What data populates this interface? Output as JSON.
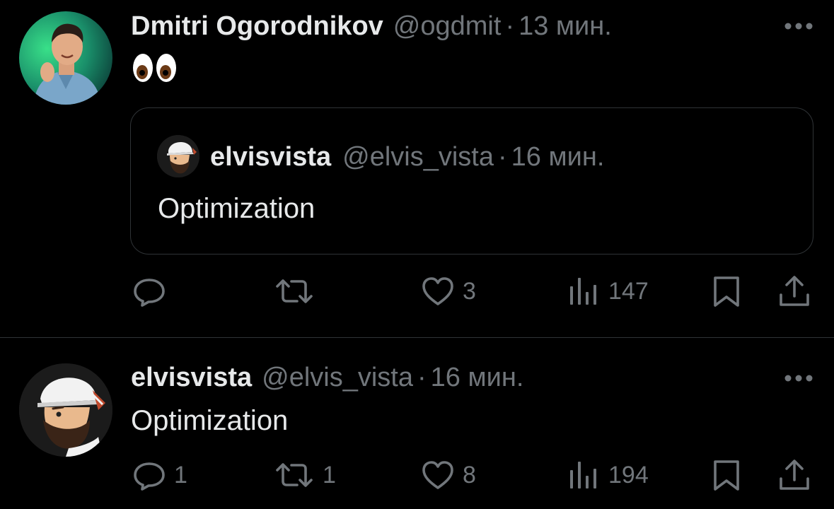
{
  "colors": {
    "background": "#000000",
    "primary_text": "#e7e9ea",
    "secondary_text": "#71767b",
    "border": "#2f3336"
  },
  "tweets": [
    {
      "author": {
        "display_name": "Dmitri Ogorodnikov",
        "handle": "@ogdmit",
        "separator": "·",
        "time": "13 мин.",
        "avatar": "photo-avatar"
      },
      "content": {
        "emoji": "eyes-emoji"
      },
      "quote": {
        "display_name": "elvisvista",
        "handle": "@elvis_vista",
        "separator": "·",
        "time": "16 мин.",
        "text": "Optimization",
        "avatar": "cartoon-avatar"
      },
      "actions": {
        "reply_count": "",
        "retweet_count": "",
        "like_count": "3",
        "view_count": "147"
      }
    },
    {
      "author": {
        "display_name": "elvisvista",
        "handle": "@elvis_vista",
        "separator": "·",
        "time": "16 мин.",
        "avatar": "cartoon-avatar"
      },
      "content": {
        "text": "Optimization"
      },
      "actions": {
        "reply_count": "1",
        "retweet_count": "1",
        "like_count": "8",
        "view_count": "194"
      }
    }
  ]
}
